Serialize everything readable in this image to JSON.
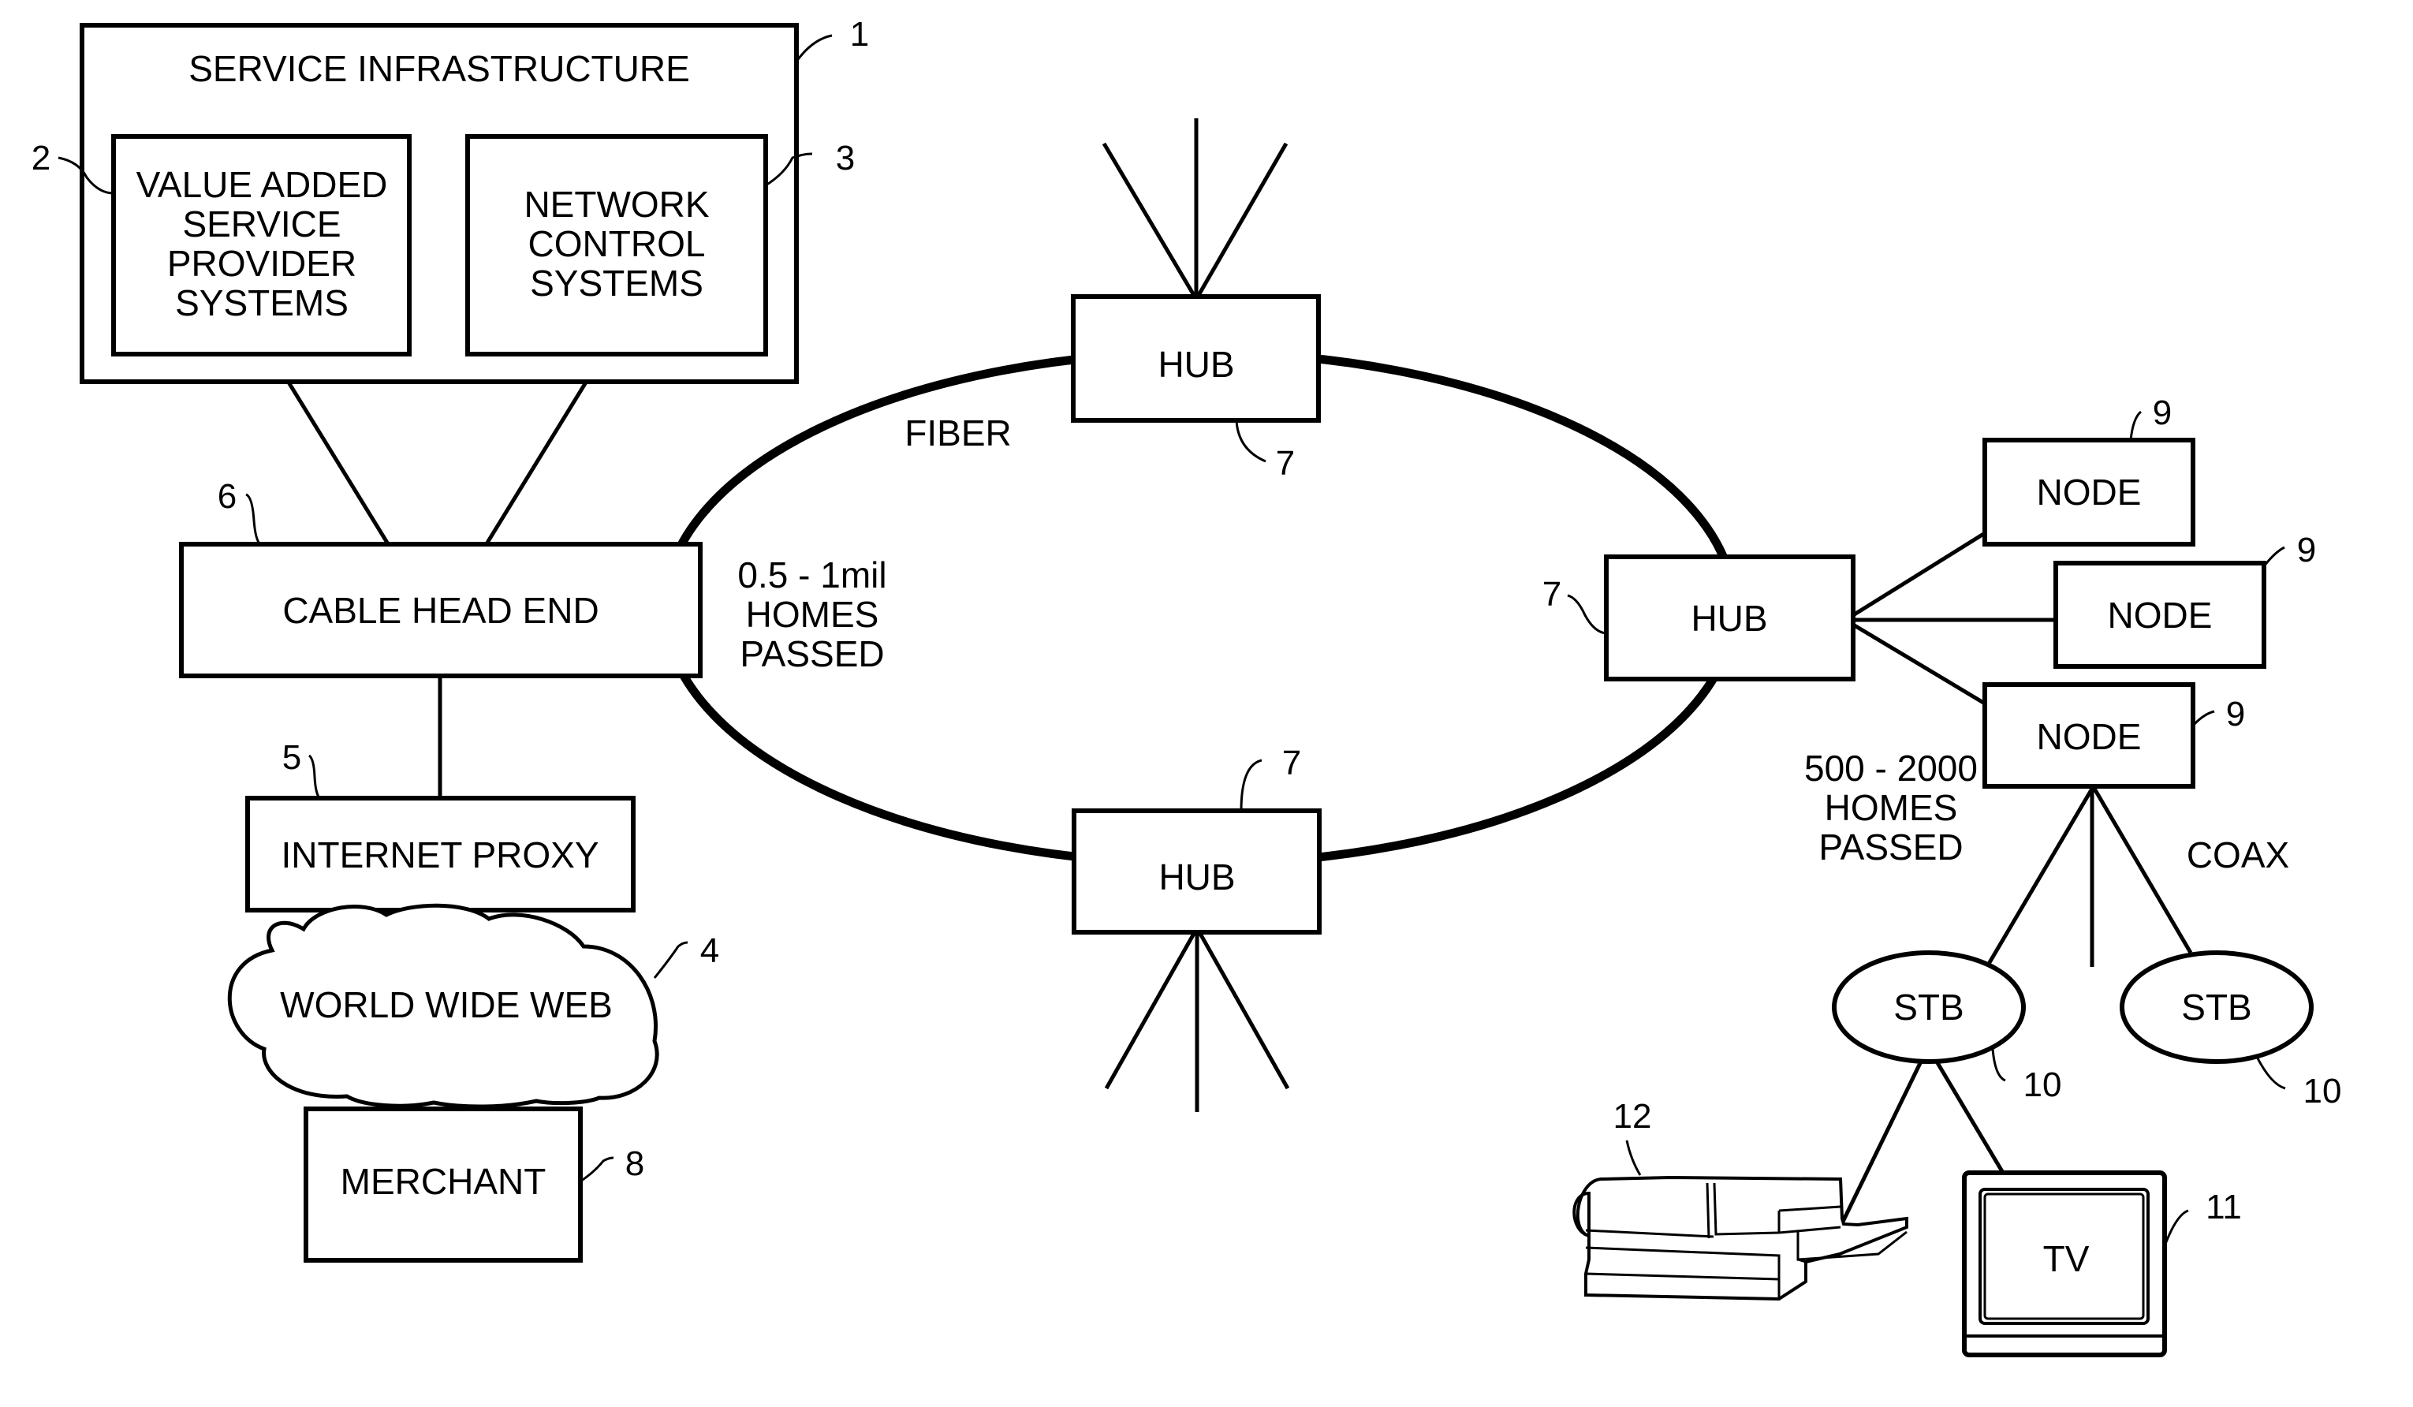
{
  "figure": {
    "service_infrastructure": {
      "label": "SERVICE INFRASTRUCTURE",
      "ref": "1"
    },
    "value_added": {
      "lines": [
        "VALUE ADDED",
        "SERVICE",
        "PROVIDER",
        "SYSTEMS"
      ],
      "ref": "2"
    },
    "network_control": {
      "lines": [
        "NETWORK",
        "CONTROL",
        "SYSTEMS"
      ],
      "ref": "3"
    },
    "world_wide_web": {
      "label": "WORLD WIDE WEB",
      "ref": "4"
    },
    "internet_proxy": {
      "label": "INTERNET PROXY",
      "ref": "5"
    },
    "cable_head_end": {
      "label": "CABLE HEAD END",
      "ref": "6"
    },
    "merchant": {
      "label": "MERCHANT",
      "ref": "8"
    },
    "hubs": [
      {
        "label": "HUB",
        "ref": "7"
      },
      {
        "label": "HUB",
        "ref": "7"
      },
      {
        "label": "HUB",
        "ref": "7"
      }
    ],
    "fiber_label": "FIBER",
    "ring_coverage": [
      "0.5 - 1mil",
      "HOMES",
      "PASSED"
    ],
    "nodes": [
      {
        "label": "NODE",
        "ref": "9"
      },
      {
        "label": "NODE",
        "ref": "9"
      },
      {
        "label": "NODE",
        "ref": "9"
      }
    ],
    "node_coverage": [
      "500 - 2000",
      "HOMES",
      "PASSED"
    ],
    "coax_label": "COAX",
    "stbs": [
      {
        "label": "STB",
        "ref": "10"
      },
      {
        "label": "STB",
        "ref": "10"
      }
    ],
    "tv": {
      "label": "TV",
      "ref": "11"
    },
    "printer": {
      "ref": "12"
    }
  }
}
